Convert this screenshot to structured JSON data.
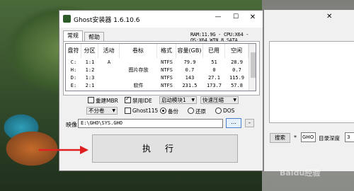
{
  "window": {
    "title": "Ghost安装器 1.6.10.6",
    "min_icon": "—",
    "max_icon": "☐",
    "close_icon": "✕"
  },
  "tabs": [
    {
      "label": "常规"
    },
    {
      "label": "帮助"
    }
  ],
  "sysinfo": "RAM:11.9G - CPU:X64 - OS:X64 WIN_8 SATA",
  "table": {
    "headers": [
      "盘符",
      "分区",
      "活动",
      "卷标",
      "格式",
      "容量(GB)",
      "已用",
      "空闲"
    ],
    "rows": [
      [
        "C:",
        "1:1",
        "A",
        "",
        "NTFS",
        "79.9",
        "51",
        "28.9"
      ],
      [
        "H:",
        "1:2",
        "",
        "图片存放",
        "NTFS",
        "0.7",
        "0",
        "0.7"
      ],
      [
        "D:",
        "1:3",
        "",
        "",
        "NTFS",
        "143",
        "27.1",
        "115.9"
      ],
      [
        "E:",
        "2:1",
        "",
        "软件",
        "NTFS",
        "231.5",
        "173.7",
        "57.8"
      ]
    ]
  },
  "options": {
    "restart_mbr": "重建MBR",
    "disable_ide": "禁用IDE",
    "boot_module": "启动模块1",
    "compression": "快速压缩",
    "split_volume": "不分卷",
    "ghost115": "Ghost115",
    "backup": "备份",
    "restore": "还原",
    "dos": "DOS"
  },
  "image": {
    "label": "映像",
    "path": "E:\\GHO\\SYS.GHO",
    "browse_label": "...",
    "minus_label": "-"
  },
  "execute_label": "执行",
  "side": {
    "close_icon": "✕",
    "search_label": "搜索",
    "star": "*",
    "ext_value": "GHO",
    "depth_label": "目录深度",
    "depth_value": "3"
  },
  "watermark": "Baidu经验",
  "colors": {
    "arrow": "#e02020",
    "browse_border": "#4a7ec8"
  }
}
